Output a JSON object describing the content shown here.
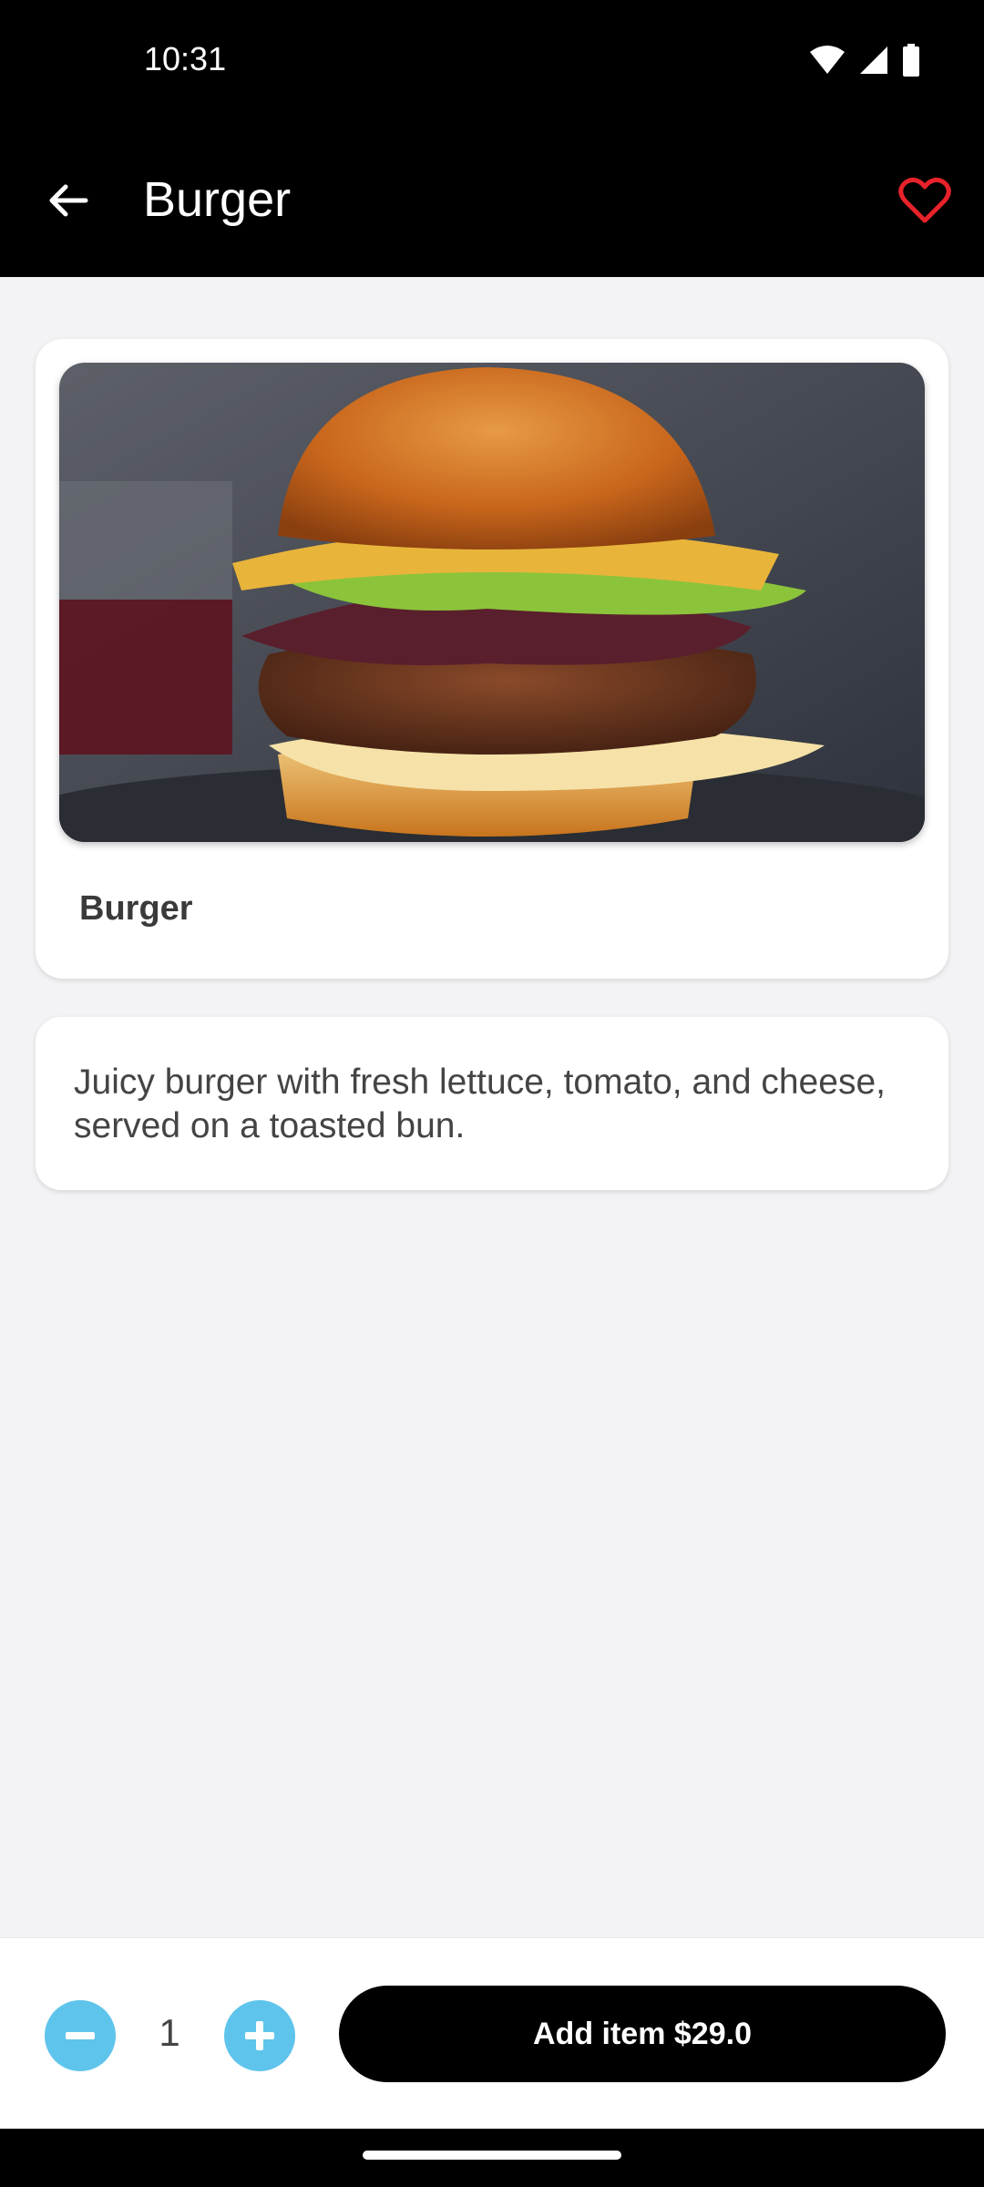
{
  "status_bar": {
    "time": "10:31"
  },
  "app_bar": {
    "title": "Burger"
  },
  "product": {
    "name": "Burger",
    "description": "Juicy burger with fresh lettuce, tomato, and cheese, served on a toasted bun."
  },
  "quantity": {
    "value": "1"
  },
  "cart": {
    "add_label": "Add item $29.0"
  },
  "colors": {
    "accent_blue": "#5ec4ec",
    "favorite_red": "#e8222a",
    "bar_black": "#000000"
  },
  "icons": {
    "back": "arrow-back-icon",
    "favorite": "heart-outline-icon",
    "minus": "minus-circle-icon",
    "plus": "plus-circle-icon"
  }
}
